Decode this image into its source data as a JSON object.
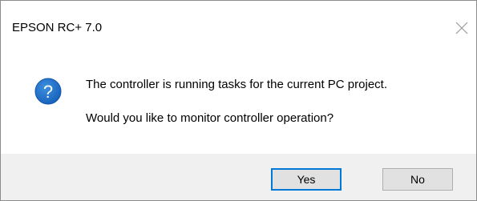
{
  "dialog": {
    "title": "EPSON RC+ 7.0",
    "close_icon": "close-icon",
    "icon": "question-icon",
    "icon_color": "#1f6fc5",
    "message_line1": "The controller is running tasks for the current PC project.",
    "message_line2": "Would you like to monitor controller operation?",
    "buttons": {
      "yes_label": "Yes",
      "no_label": "No"
    },
    "accent_color": "#0078d7"
  }
}
